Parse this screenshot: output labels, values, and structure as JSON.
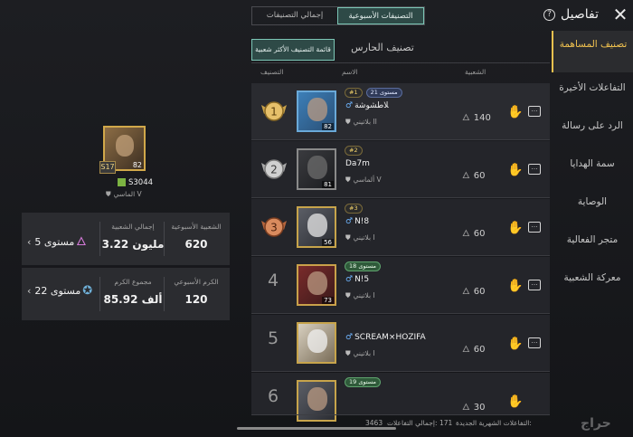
{
  "header": {
    "title": "تفاصيل",
    "help_label": "?",
    "close_label": "✕",
    "tabs": [
      {
        "label": "إجمالي التصنيفات",
        "active": false
      },
      {
        "label": "التصنيفات الأسبوعية",
        "active": true
      }
    ]
  },
  "side_menu": {
    "items": [
      {
        "label": "تصنيف المساهمة",
        "active": true
      },
      {
        "label": "التفاعلات الأخيرة"
      },
      {
        "label": "الرد على رسالة"
      },
      {
        "label": "سمة الهدايا"
      },
      {
        "label": "الوصاية"
      },
      {
        "label": "متجر الفعالية"
      },
      {
        "label": "معركة الشعبية"
      }
    ]
  },
  "list": {
    "sub_tab_active": "قائمة التصنيف الأكثر شعبية",
    "sub_tab": "تصنيف الحارس",
    "columns": {
      "rank": "التصنيف",
      "name": "الاسم",
      "popularity": "الشعبية"
    },
    "rows": [
      {
        "rank": "1",
        "rank_pill": "#1",
        "level_pill": "مستوى 21",
        "name": "ﻼطشوشة",
        "tier": "بلاتيني II",
        "avatar_level": "82",
        "popularity": "140"
      },
      {
        "rank": "2",
        "rank_pill": "#2",
        "level_pill": "",
        "name": "Da7m",
        "tier": "ألماسي V",
        "avatar_level": "81",
        "popularity": "60"
      },
      {
        "rank": "3",
        "rank_pill": "#3",
        "level_pill": "",
        "name": "N!8",
        "tier": "بلاتيني I",
        "avatar_level": "56",
        "popularity": "60"
      },
      {
        "rank": "4",
        "rank_pill": "",
        "level_pill": "مستوى 18",
        "name": "N!5",
        "tier": "بلاتيني I",
        "avatar_level": "73",
        "popularity": "60"
      },
      {
        "rank": "5",
        "rank_pill": "",
        "level_pill": "",
        "name": "SCREAM×HOZIFA",
        "tier": "بلاتيني I",
        "avatar_level": "",
        "popularity": "60"
      },
      {
        "rank": "6",
        "rank_pill": "",
        "level_pill": "مستوى 19",
        "name": "",
        "tier": "",
        "avatar_level": "",
        "popularity": "30"
      }
    ]
  },
  "footer": {
    "monthly_new_label": "التفاعلات الشهرية الجديدة:",
    "monthly_new_value": "171",
    "total_label": "إجمالي التفاعلات:",
    "total_value": "3463",
    "watermark": "حراج"
  },
  "profile": {
    "card_level": "82",
    "badge": "S17",
    "name": "S3044",
    "tier": "الماسي V",
    "stats_popularity": {
      "weekly_label": "الشعبية الأسبوعية",
      "weekly_value": "620",
      "total_label": "إجمالي الشعبية",
      "total_value": "3.22 مليون",
      "level_label": "مستوى 5"
    },
    "stats_generosity": {
      "weekly_label": "الكرم الأسبوعي",
      "weekly_value": "120",
      "total_label": "مجموع الكرم",
      "total_value": "85.92 ألف",
      "level_label": "مستوى 22"
    }
  }
}
